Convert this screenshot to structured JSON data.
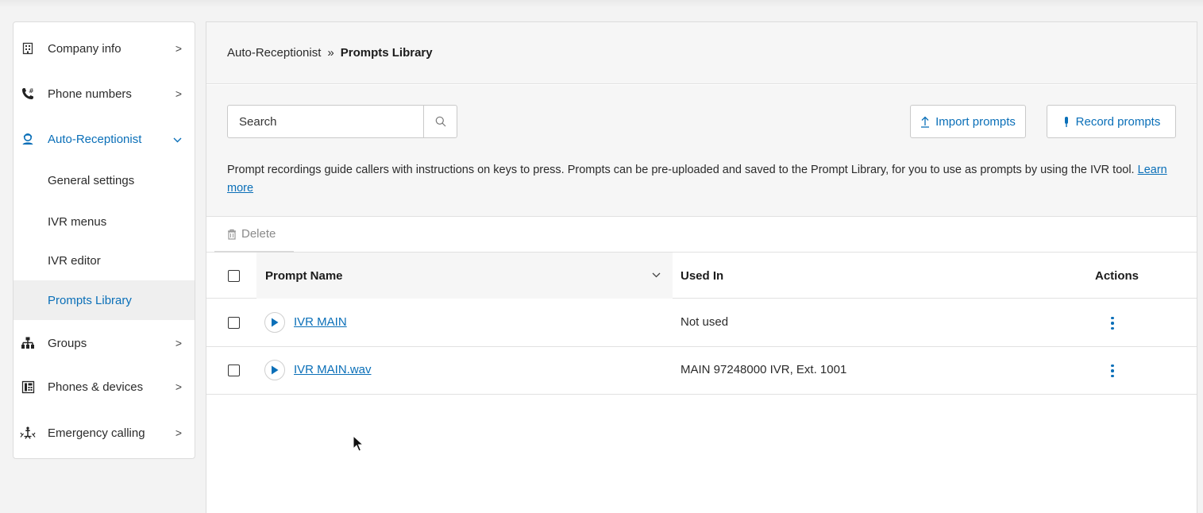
{
  "sidebar": {
    "items": [
      {
        "label": "Company info",
        "icon": "building-icon",
        "chevron": ">"
      },
      {
        "label": "Phone numbers",
        "icon": "phone-hash-icon",
        "chevron": ">"
      },
      {
        "label": "Auto-Receptionist",
        "icon": "receptionist-icon",
        "chevron": "⌄"
      },
      {
        "label": "Groups",
        "icon": "org-chart-icon",
        "chevron": ">"
      },
      {
        "label": "Phones & devices",
        "icon": "desk-phone-icon",
        "chevron": ">"
      },
      {
        "label": "Emergency calling",
        "icon": "emergency-icon",
        "chevron": ">"
      }
    ],
    "subitems": [
      {
        "label": "General settings"
      },
      {
        "label": "IVR menus"
      },
      {
        "label": "IVR editor"
      },
      {
        "label": "Prompts Library"
      }
    ]
  },
  "breadcrumb": {
    "parent": "Auto-Receptionist",
    "separator": "»",
    "current": "Prompts Library"
  },
  "toolbar": {
    "search_placeholder": "Search",
    "import_label": "Import prompts",
    "record_label": "Record prompts",
    "description": "Prompt recordings guide callers with instructions on keys to press. Prompts can be pre-uploaded and saved to the Prompt Library, for you to use as prompts by using the IVR tool.",
    "learn_more": "Learn more",
    "delete_label": "Delete"
  },
  "table": {
    "columns": {
      "name": "Prompt Name",
      "used_in": "Used In",
      "actions": "Actions"
    },
    "rows": [
      {
        "name": "IVR MAIN",
        "used_in": "Not used"
      },
      {
        "name": "IVR MAIN.wav",
        "used_in": "MAIN 97248000 IVR, Ext. 1001"
      }
    ]
  },
  "colors": {
    "accent": "#0a6fb8",
    "panel_bg": "#f6f6f6",
    "border": "#dcdcdc"
  }
}
